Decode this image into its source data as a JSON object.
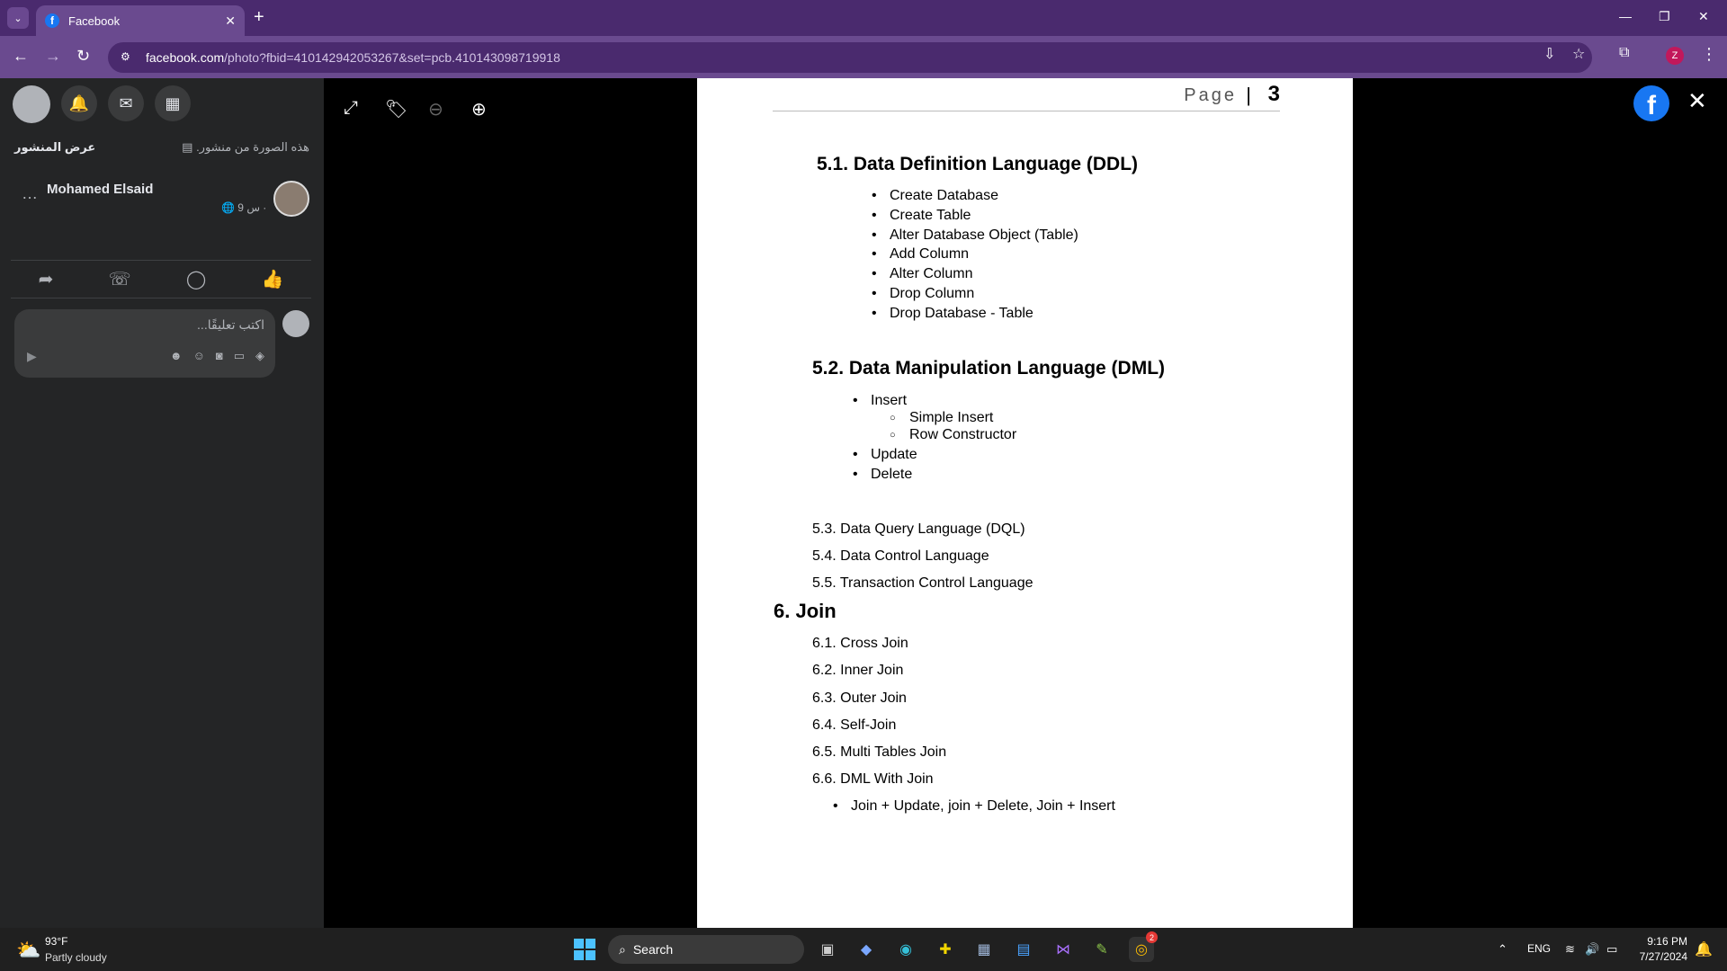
{
  "browser": {
    "tab_title": "Facebook",
    "tab_favicon": "f",
    "new_tab": "+",
    "url_host": "facebook.com",
    "url_rest": "/photo?fbid=410142942053267&set=pcb.410143098719918",
    "profile_initial": "Z"
  },
  "sidebar": {
    "view_post": "عرض المنشور",
    "from_post_note": "هذه الصورة من منشور.",
    "author_name": "Mohamed Elsaid",
    "author_time": "9 س ·",
    "comment_placeholder": "اكتب تعليقًا..."
  },
  "document": {
    "page_label": "Page",
    "page_bar": "|",
    "page_number": "3",
    "ddl_heading": "5.1. Data Definition Language (DDL)",
    "ddl_items": [
      "Create Database",
      "Create Table",
      "Alter Database Object (Table)",
      "Add Column",
      "Alter Column",
      "Drop Column",
      "Drop Database - Table"
    ],
    "dml_heading": "5.2. Data Manipulation Language (DML)",
    "dml_insert": "Insert",
    "dml_insert_subs": [
      "Simple Insert",
      "Row Constructor"
    ],
    "dml_update": "Update",
    "dml_delete": "Delete",
    "dql": "5.3. Data Query Language (DQL)",
    "dcl": "5.4. Data Control Language",
    "tcl": "5.5. Transaction Control Language",
    "join_heading": "6. Join",
    "join_items": [
      "6.1. Cross Join",
      "6.2. Inner Join",
      "6.3. Outer Join",
      "6.4. Self-Join",
      "6.5. Multi Tables Join",
      "6.6. DML With Join"
    ],
    "join_bullet": "Join + Update, join + Delete, Join + Insert"
  },
  "taskbar": {
    "weather_temp": "93°F",
    "weather_desc": "Partly cloudy",
    "search_label": "Search",
    "language": "ENG",
    "time": "9:16 PM",
    "date": "7/27/2024",
    "chrome_badge": "2"
  }
}
